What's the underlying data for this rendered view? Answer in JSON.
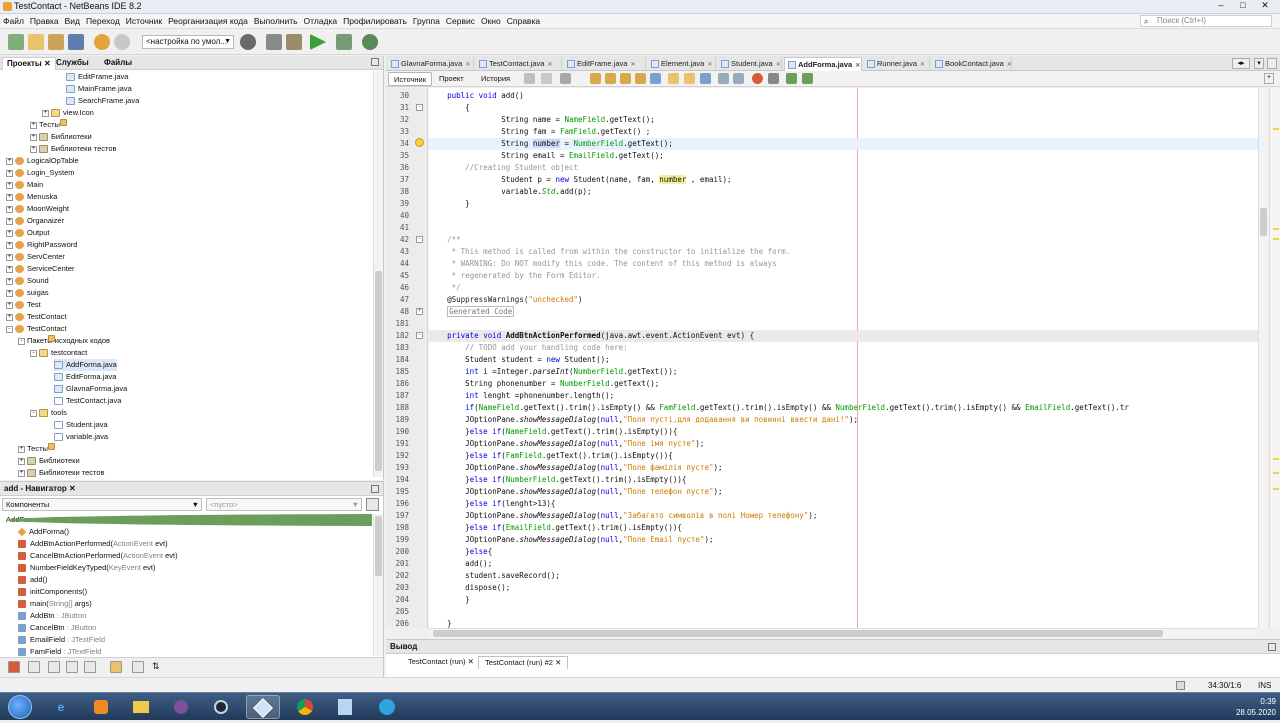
{
  "window": {
    "title": "TestContact - NetBeans IDE 8.2"
  },
  "menu": [
    "Файл",
    "Правка",
    "Вид",
    "Переход",
    "Источник",
    "Реорганизация кода",
    "Выполнить",
    "Отладка",
    "Профилировать",
    "Группа",
    "Сервис",
    "Окно",
    "Справка"
  ],
  "search": {
    "placeholder": "Поиск (Ctrl+I)"
  },
  "toolbar": {
    "config": "<настройка по умол..."
  },
  "projects": {
    "tabs": [
      "Проекты",
      "Службы",
      "Файлы"
    ],
    "tree": [
      {
        "label": "EditFrame.java",
        "indent": 5,
        "icon": "form"
      },
      {
        "label": "MainFrame.java",
        "indent": 5,
        "icon": "form"
      },
      {
        "label": "SearchFrame.java",
        "indent": 5,
        "icon": "form"
      },
      {
        "label": "view.Icon",
        "indent": 3,
        "icon": "pkg",
        "exp": "+"
      },
      {
        "label": "Тесты",
        "indent": 2,
        "icon": "fold",
        "exp": "+"
      },
      {
        "label": "Библиотеки",
        "indent": 2,
        "icon": "lib",
        "exp": "+"
      },
      {
        "label": "Библиотеки тестов",
        "indent": 2,
        "icon": "lib",
        "exp": "+"
      },
      {
        "label": "LogicalOpTable",
        "indent": 0,
        "icon": "proj",
        "exp": "+"
      },
      {
        "label": "Login_System",
        "indent": 0,
        "icon": "proj",
        "exp": "+"
      },
      {
        "label": "Main",
        "indent": 0,
        "icon": "proj",
        "exp": "+"
      },
      {
        "label": "Menuska",
        "indent": 0,
        "icon": "proj",
        "exp": "+"
      },
      {
        "label": "MoonWeight",
        "indent": 0,
        "icon": "proj",
        "exp": "+"
      },
      {
        "label": "Organaizer",
        "indent": 0,
        "icon": "proj",
        "exp": "+"
      },
      {
        "label": "Output",
        "indent": 0,
        "icon": "proj",
        "exp": "+"
      },
      {
        "label": "RightPassword",
        "indent": 0,
        "icon": "proj",
        "exp": "+"
      },
      {
        "label": "ServCenter",
        "indent": 0,
        "icon": "proj",
        "exp": "+"
      },
      {
        "label": "ServiceCenter",
        "indent": 0,
        "icon": "proj",
        "exp": "+"
      },
      {
        "label": "Sound",
        "indent": 0,
        "icon": "proj",
        "exp": "+"
      },
      {
        "label": "suigas",
        "indent": 0,
        "icon": "proj",
        "exp": "+"
      },
      {
        "label": "Test",
        "indent": 0,
        "icon": "proj",
        "exp": "+"
      },
      {
        "label": "TestContact",
        "indent": 0,
        "icon": "proj",
        "exp": "+"
      },
      {
        "label": "TestContact",
        "indent": 0,
        "icon": "proj",
        "exp": "-"
      },
      {
        "label": "Пакеты исходных кодов",
        "indent": 1,
        "icon": "fold",
        "exp": "-"
      },
      {
        "label": "testcontact",
        "indent": 2,
        "icon": "pkg",
        "exp": "-"
      },
      {
        "label": "AddForma.java",
        "indent": 4,
        "icon": "form",
        "sel": true
      },
      {
        "label": "EditForma.java",
        "indent": 4,
        "icon": "form"
      },
      {
        "label": "GlavnaForma.java",
        "indent": 4,
        "icon": "form"
      },
      {
        "label": "TestContact.java",
        "indent": 4,
        "icon": "java"
      },
      {
        "label": "tools",
        "indent": 2,
        "icon": "pkg",
        "exp": "-"
      },
      {
        "label": "Student.java",
        "indent": 4,
        "icon": "java"
      },
      {
        "label": "variable.java",
        "indent": 4,
        "icon": "java"
      },
      {
        "label": "Тесты",
        "indent": 1,
        "icon": "fold",
        "exp": "+"
      },
      {
        "label": "Библиотеки",
        "indent": 1,
        "icon": "lib",
        "exp": "+"
      },
      {
        "label": "Библиотеки тестов",
        "indent": 1,
        "icon": "lib",
        "exp": "+"
      }
    ]
  },
  "navigator": {
    "title": "add - Навигатор",
    "filter": "Компоненты",
    "empty": "<пусто>",
    "items": [
      {
        "name": "AddForma",
        "suffix": " :: JFrame",
        "icon": "cl",
        "indent": 0
      },
      {
        "name": "AddForma()",
        "suffix": "",
        "icon": "c",
        "indent": 1
      },
      {
        "name": "AddBtnActionPerformed(",
        "suffix": "ActionEvent",
        "tail": " evt)",
        "icon": "m",
        "indent": 1
      },
      {
        "name": "CancelBtnActionPerformed(",
        "suffix": "ActionEvent",
        "tail": " evt)",
        "icon": "m",
        "indent": 1
      },
      {
        "name": "NumberFieldKeyTyped(",
        "suffix": "KeyEvent",
        "tail": " evt)",
        "icon": "m",
        "indent": 1
      },
      {
        "name": "add()",
        "suffix": "",
        "icon": "m",
        "indent": 1
      },
      {
        "name": "initComponents()",
        "suffix": "",
        "icon": "m",
        "indent": 1
      },
      {
        "name": "main(",
        "suffix": "String[]",
        "tail": " args)",
        "icon": "m",
        "indent": 1
      },
      {
        "name": "AddBtn",
        "suffix": " : JButton",
        "icon": "f",
        "indent": 1
      },
      {
        "name": "CancelBtn",
        "suffix": " : JButton",
        "icon": "f",
        "indent": 1
      },
      {
        "name": "EmailField",
        "suffix": " : JTextField",
        "icon": "f",
        "indent": 1
      },
      {
        "name": "FamField",
        "suffix": " : JTextField",
        "icon": "f",
        "indent": 1
      }
    ]
  },
  "editor": {
    "tabs": [
      "GlavnaForma.java",
      "TestContact.java",
      "EditFrame.java",
      "Element.java",
      "Student.java",
      "AddForma.java",
      "Runner.java",
      "BookContact.java"
    ],
    "active_tab": "AddForma.java",
    "views": [
      "Источник",
      "Проект",
      "История"
    ],
    "line_numbers": [
      "30",
      "31",
      "32",
      "33",
      "34",
      "35",
      "36",
      "37",
      "38",
      "39",
      "40",
      "41",
      "42",
      "43",
      "44",
      "45",
      "46",
      "47",
      "48",
      "181",
      "182",
      "183",
      "184",
      "185",
      "186",
      "187",
      "188",
      "189",
      "190",
      "191",
      "192",
      "193",
      "194",
      "195",
      "196",
      "197",
      "198",
      "199",
      "200",
      "201",
      "202",
      "203",
      "204",
      "205",
      "206"
    ]
  },
  "output": {
    "title": "Вывод",
    "tabs": [
      "TestContact (run)",
      "TestContact (run) #2"
    ]
  },
  "status": {
    "position": "34:30/1:6",
    "mode": "INS"
  },
  "taskbar": {
    "time": "0:39",
    "date": "28.05.2020"
  }
}
